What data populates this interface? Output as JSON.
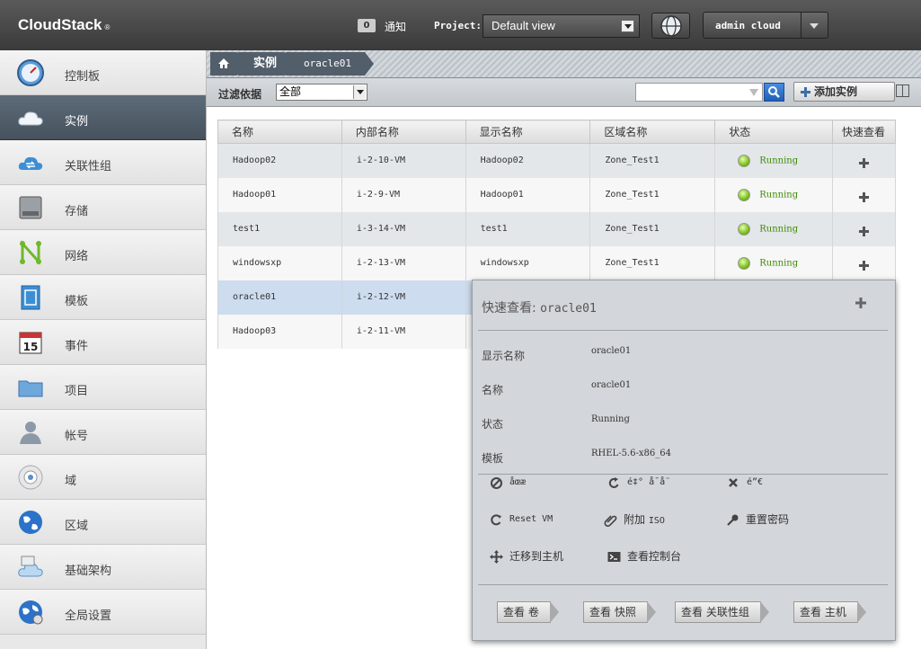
{
  "app": {
    "brand": "CloudStack",
    "brand_mark": "®"
  },
  "header": {
    "notification_count": "0",
    "notification_label": "通知",
    "project_label": "Project:",
    "project_selected": "Default view",
    "user_label": "admin cloud"
  },
  "sidebar": {
    "items": [
      {
        "label": "控制板",
        "icon": "dashboard-icon"
      },
      {
        "label": "实例",
        "icon": "cloud-icon"
      },
      {
        "label": "关联性组",
        "icon": "affinity-icon"
      },
      {
        "label": "存储",
        "icon": "storage-icon"
      },
      {
        "label": "网络",
        "icon": "network-icon"
      },
      {
        "label": "模板",
        "icon": "template-icon"
      },
      {
        "label": "事件",
        "icon": "calendar-icon"
      },
      {
        "label": "项目",
        "icon": "folder-icon"
      },
      {
        "label": "帐号",
        "icon": "user-icon"
      },
      {
        "label": "域",
        "icon": "domain-icon"
      },
      {
        "label": "区域",
        "icon": "globe-icon"
      },
      {
        "label": "基础架构",
        "icon": "infrastructure-icon"
      },
      {
        "label": "全局设置",
        "icon": "global-settings-icon"
      }
    ],
    "active_index": 1
  },
  "breadcrumb": {
    "section": "实例",
    "current": "oracle01"
  },
  "filterbar": {
    "label": "过滤依据",
    "selected": "全部",
    "search_placeholder": "",
    "add_button": "添加实例"
  },
  "table": {
    "columns": [
      "名称",
      "内部名称",
      "显示名称",
      "区域名称",
      "状态",
      "快速查看"
    ],
    "rows": [
      {
        "name": "Hadoop02",
        "internal": "i-2-10-VM",
        "display": "Hadoop02",
        "zone": "Zone_Test1",
        "state": "Running"
      },
      {
        "name": "Hadoop01",
        "internal": "i-2-9-VM",
        "display": "Hadoop01",
        "zone": "Zone_Test1",
        "state": "Running"
      },
      {
        "name": "test1",
        "internal": "i-3-14-VM",
        "display": "test1",
        "zone": "Zone_Test1",
        "state": "Running"
      },
      {
        "name": "windowsxp",
        "internal": "i-2-13-VM",
        "display": "windowsxp",
        "zone": "Zone_Test1",
        "state": "Running"
      },
      {
        "name": "oracle01",
        "internal": "i-2-12-VM",
        "display": "",
        "zone": "",
        "state": ""
      },
      {
        "name": "Hadoop03",
        "internal": "i-2-11-VM",
        "display": "",
        "zone": "",
        "state": ""
      }
    ]
  },
  "quickview": {
    "title_prefix": "快速查看:",
    "title_name": "oracle01",
    "fields": [
      {
        "key": "显示名称",
        "value": "oracle01"
      },
      {
        "key": "名称",
        "value": "oracle01"
      },
      {
        "key": "状态",
        "value": "Running"
      },
      {
        "key": "模板",
        "value": "RHEL-5.6-x86_64"
      }
    ],
    "actions": {
      "stop": "åœæ",
      "reboot": "é‡° å¯å¨",
      "destroy": "é”€",
      "reset_vm": "Reset VM",
      "attach_prefix": "附加 ",
      "attach_iso": "ISO",
      "reset_password": "重置密码",
      "migrate": "迁移到主机",
      "console": "查看控制台"
    },
    "view_buttons": [
      "查看 卷",
      "查看 快照",
      "查看 关联性组",
      "查看 主机"
    ]
  },
  "colors": {
    "running": "#3a8a00",
    "active_nav": "#4f5c68",
    "search_btn": "#2b6fc9"
  }
}
